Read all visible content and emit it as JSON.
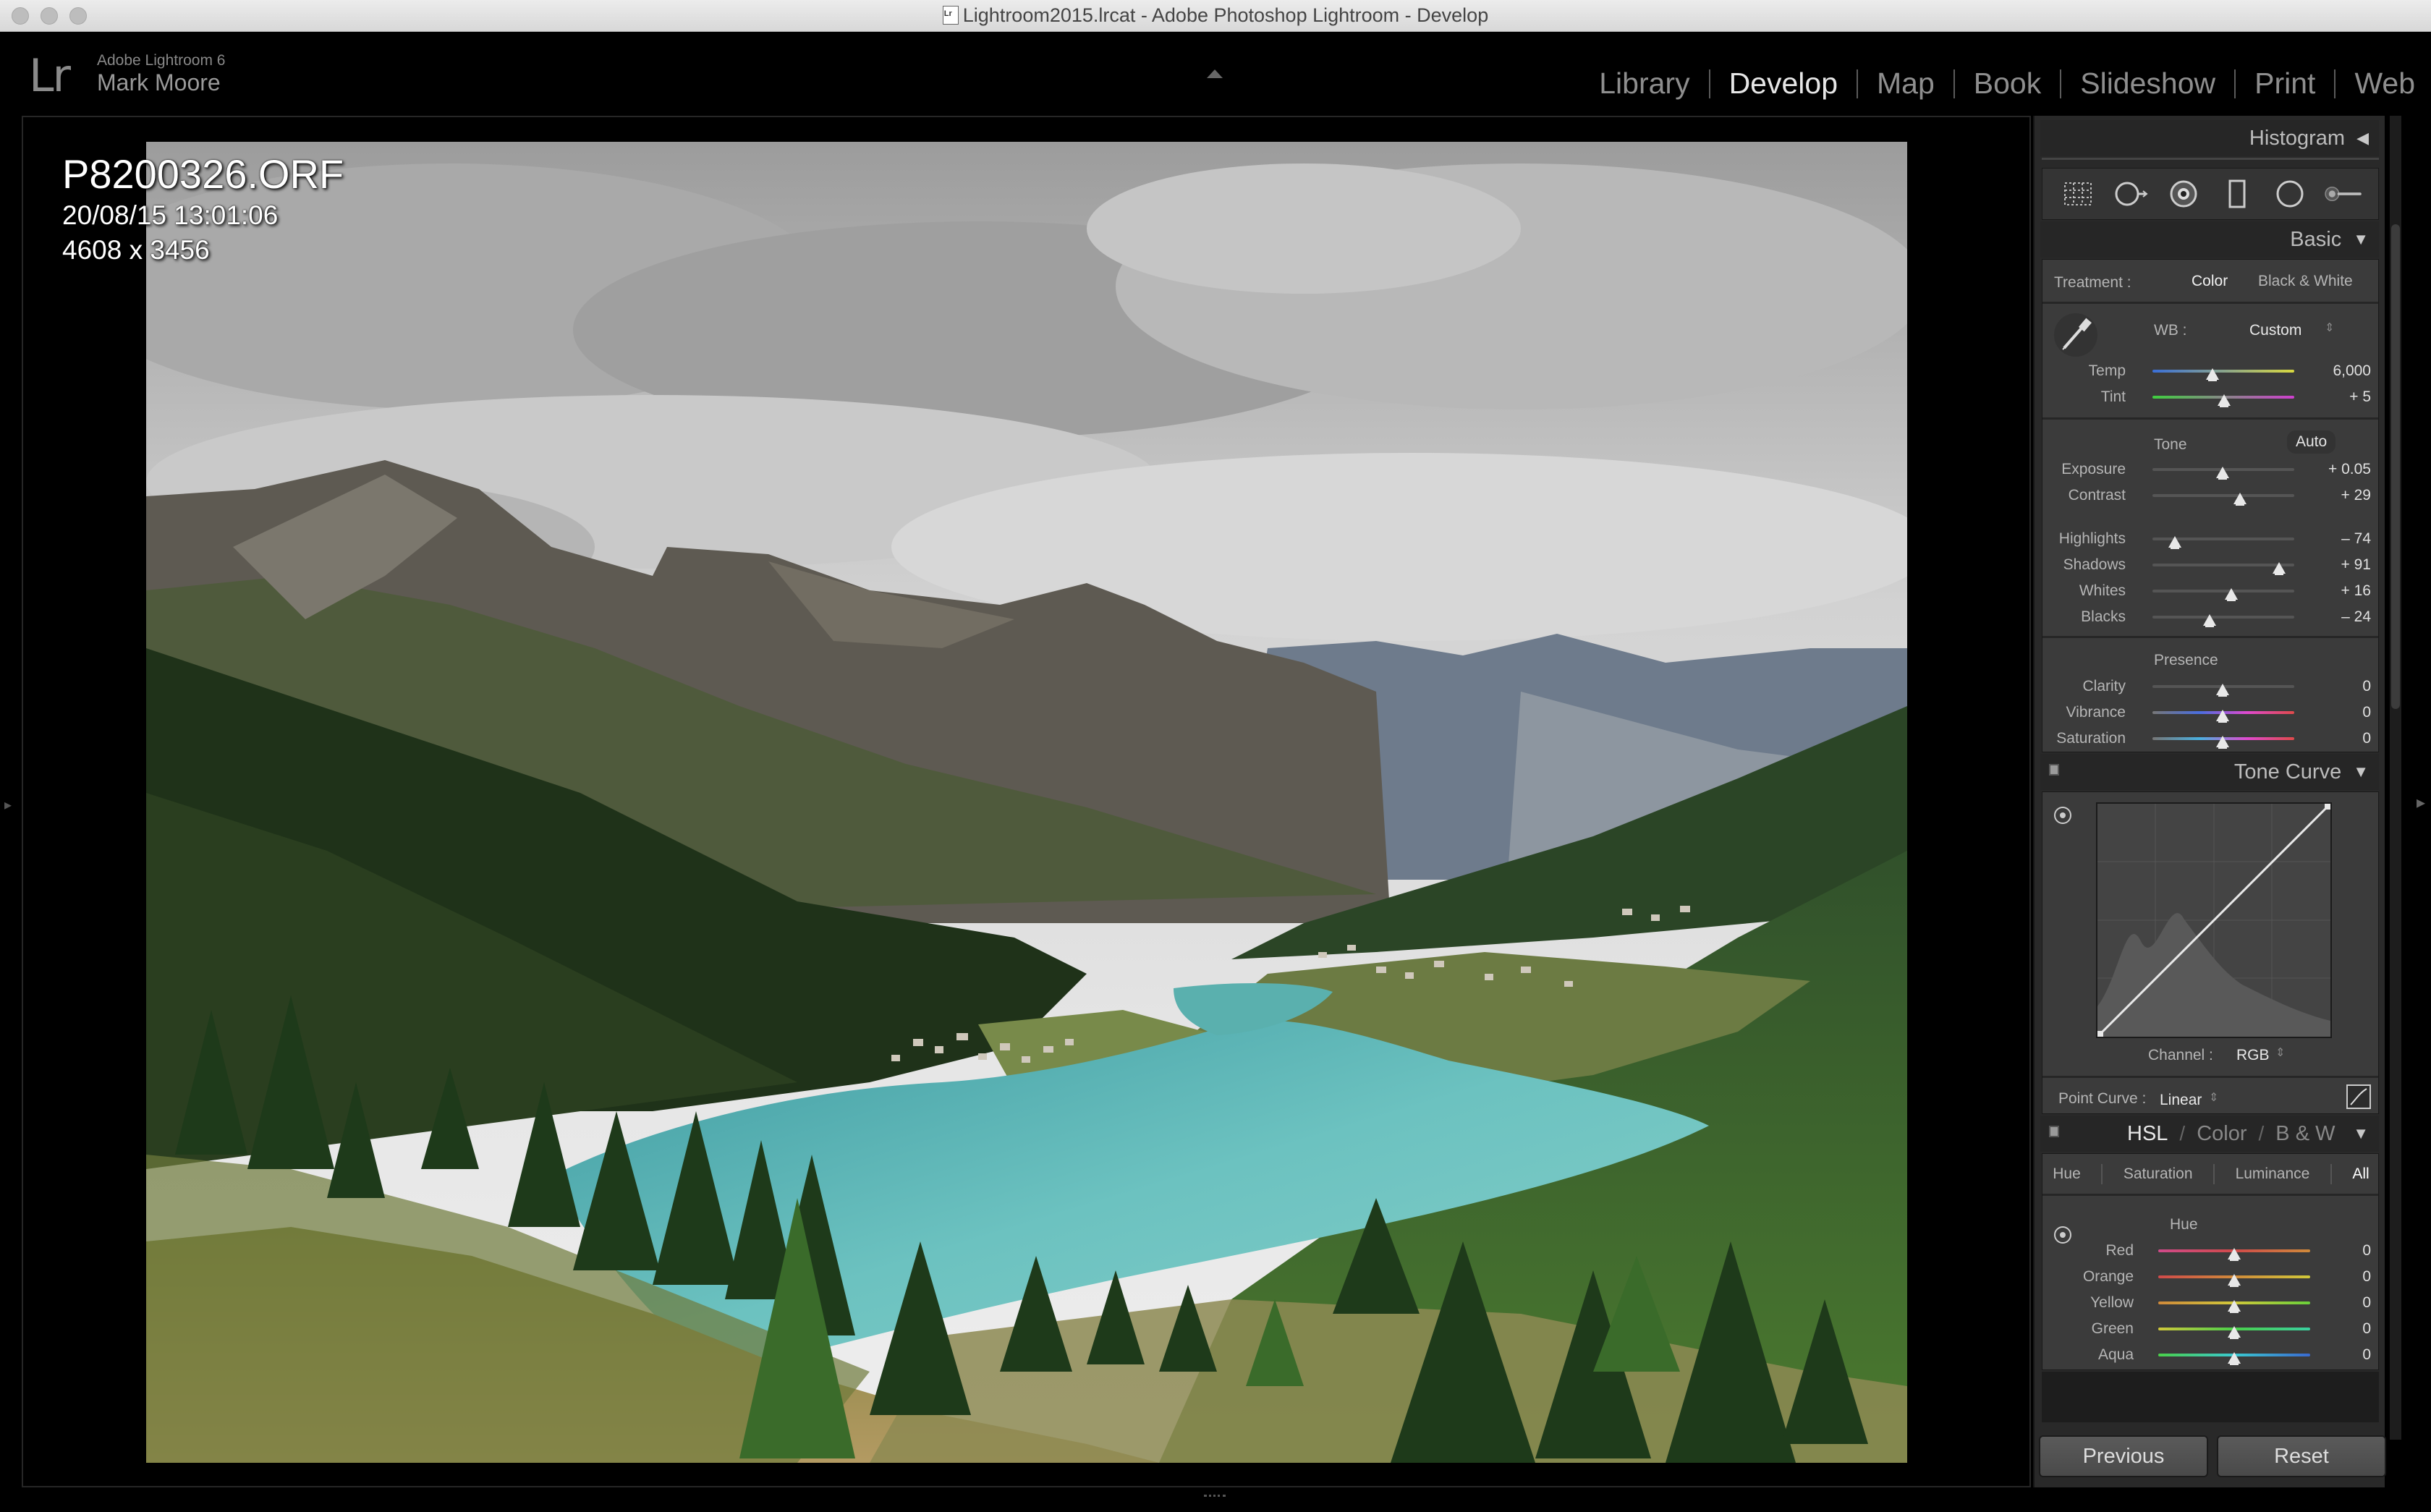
{
  "window": {
    "title": "Lightroom2015.lrcat - Adobe Photoshop Lightroom - Develop"
  },
  "identity": {
    "app": "Adobe Lightroom 6",
    "user": "Mark Moore"
  },
  "modules": [
    "Library",
    "Develop",
    "Map",
    "Book",
    "Slideshow",
    "Print",
    "Web"
  ],
  "active_module": "Develop",
  "photo_info": {
    "filename": "P8200326.ORF",
    "datetime": "20/08/15 13:01:06",
    "dimensions": "4608 x 3456"
  },
  "panels": {
    "histogram": "Histogram",
    "basic": "Basic",
    "tone_curve": "Tone Curve"
  },
  "basic": {
    "treatment_label": "Treatment :",
    "treatment_color": "Color",
    "treatment_bw": "Black & White",
    "wb_label": "WB :",
    "wb_value": "Custom",
    "tone_label": "Tone",
    "auto_label": "Auto",
    "presence_label": "Presence",
    "sliders": {
      "temp": {
        "label": "Temp",
        "value": "6,000",
        "pos": 0.4
      },
      "tint": {
        "label": "Tint",
        "value": "+ 5",
        "pos": 0.51
      },
      "exposure": {
        "label": "Exposure",
        "value": "+ 0.05",
        "pos": 0.5
      },
      "contrast": {
        "label": "Contrast",
        "value": "+ 29",
        "pos": 0.62
      },
      "highlights": {
        "label": "Highlights",
        "value": "– 74",
        "pos": 0.16
      },
      "shadows": {
        "label": "Shadows",
        "value": "+ 91",
        "pos": 0.9
      },
      "whites": {
        "label": "Whites",
        "value": "+ 16",
        "pos": 0.56
      },
      "blacks": {
        "label": "Blacks",
        "value": "– 24",
        "pos": 0.4
      },
      "clarity": {
        "label": "Clarity",
        "value": "0",
        "pos": 0.5
      },
      "vibrance": {
        "label": "Vibrance",
        "value": "0",
        "pos": 0.5
      },
      "saturation": {
        "label": "Saturation",
        "value": "0",
        "pos": 0.5
      }
    }
  },
  "tone_curve": {
    "channel_label": "Channel :",
    "channel_value": "RGB",
    "point_curve_label": "Point Curve :",
    "point_curve_value": "Linear"
  },
  "hsl": {
    "tabs": [
      "HSL",
      "Color",
      "B & W"
    ],
    "subtabs": [
      "Hue",
      "Saturation",
      "Luminance",
      "All"
    ],
    "section": "Hue",
    "sliders": [
      {
        "label": "Red",
        "value": "0",
        "pos": 0.5
      },
      {
        "label": "Orange",
        "value": "0",
        "pos": 0.5
      },
      {
        "label": "Yellow",
        "value": "0",
        "pos": 0.5
      },
      {
        "label": "Green",
        "value": "0",
        "pos": 0.5
      },
      {
        "label": "Aqua",
        "value": "0",
        "pos": 0.5
      }
    ]
  },
  "buttons": {
    "previous": "Previous",
    "reset": "Reset"
  },
  "colors": {
    "panel_bg": "#3b3b3b",
    "accent_text": "#e6e6e6",
    "lake": "#5fb6b5"
  },
  "icons": [
    "crop-overlay-icon",
    "spot-removal-icon",
    "red-eye-icon",
    "graduated-filter-icon",
    "radial-filter-icon",
    "adjustment-brush-icon",
    "eyedropper-icon",
    "target-adjustment-icon"
  ]
}
